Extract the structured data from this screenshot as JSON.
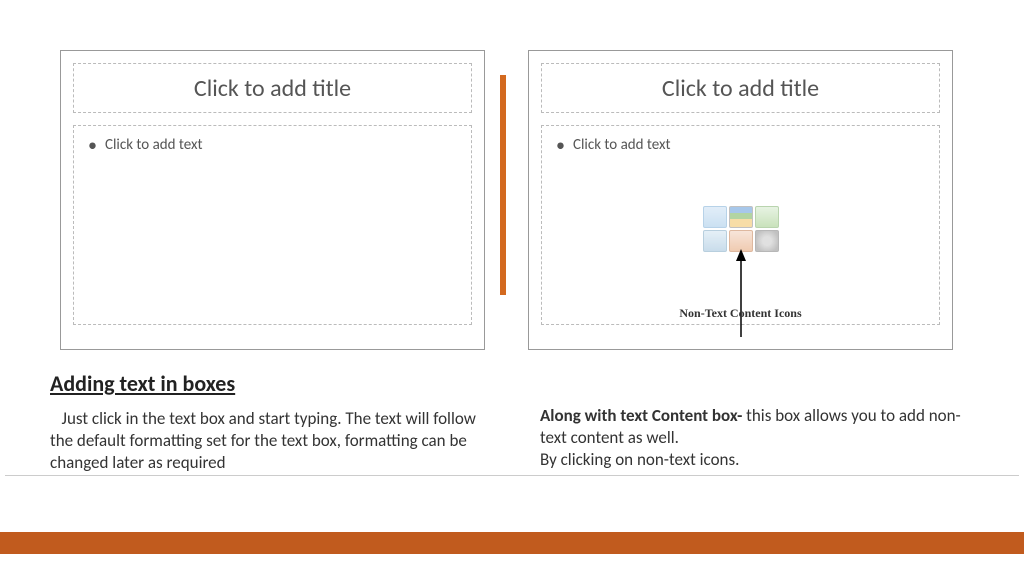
{
  "leftSlide": {
    "title": "Click to add title",
    "bullet": "Click to add text"
  },
  "rightSlide": {
    "title": "Click to add title",
    "bullet": "Click to add text",
    "caption": "Non-Text Content Icons"
  },
  "heading": "Adding text in boxes",
  "paraLeft": "Just click in the text box and start typing. The text will follow the default formatting set for the text box, formatting can be changed later as required",
  "paraRight": {
    "bold": "Along with text Content box- ",
    "rest1": "this box allows you to add non-text content as well.",
    "rest2": "By clicking on non-text icons."
  }
}
